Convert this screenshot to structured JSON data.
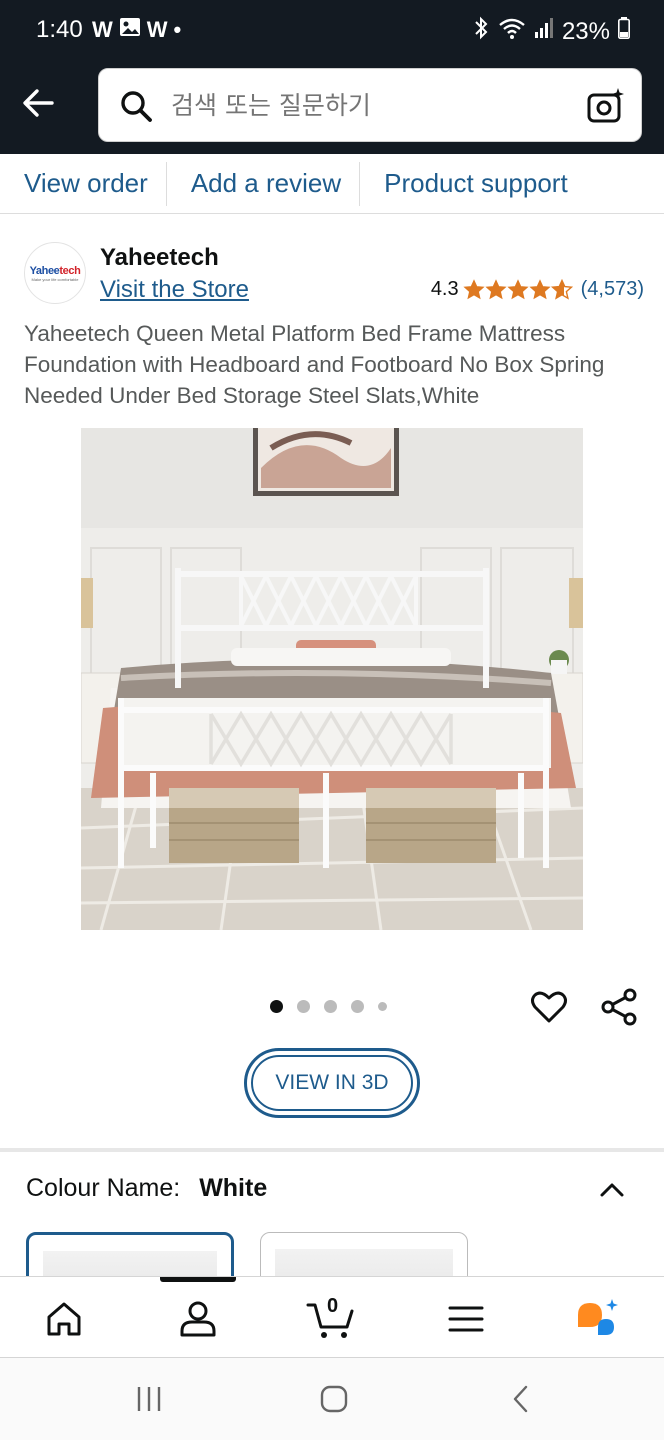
{
  "status_bar": {
    "time": "1:40",
    "left_icons": [
      "W",
      "gallery-icon",
      "W",
      "•"
    ],
    "battery": "23%"
  },
  "search": {
    "placeholder": "검색 또는 질문하기"
  },
  "sub_nav": {
    "items": [
      "View order",
      "Add a review",
      "Product support"
    ]
  },
  "brand": {
    "logo_text_a": "Yahee",
    "logo_text_b": "tech",
    "logo_tagline": "Make your life comfortable",
    "name": "Yaheetech",
    "visit_store": "Visit the Store",
    "rating_value": "4.3",
    "rating_count": "(4,573)",
    "rating_stars": 4.3
  },
  "product": {
    "title": "Yaheetech Queen Metal Platform Bed Frame Mattress Foundation with Headboard and Footboard No Box Spring Needed Under Bed Storage Steel Slats,White"
  },
  "carousel": {
    "total_dots": 5,
    "active_index": 0
  },
  "view3d": {
    "label": "VIEW IN 3D"
  },
  "colour": {
    "label": "Colour Name:",
    "value": "White"
  },
  "bottom_nav": {
    "cart_count": "0",
    "items": [
      "home-icon",
      "account-icon",
      "cart-icon",
      "menu-icon",
      "rufus-icon"
    ]
  },
  "colors": {
    "header_bg": "#131a22",
    "link": "#1e5b8c",
    "star": "#de7921",
    "rufus_orange": "#ff8a1f",
    "rufus_blue": "#1e88e5"
  }
}
